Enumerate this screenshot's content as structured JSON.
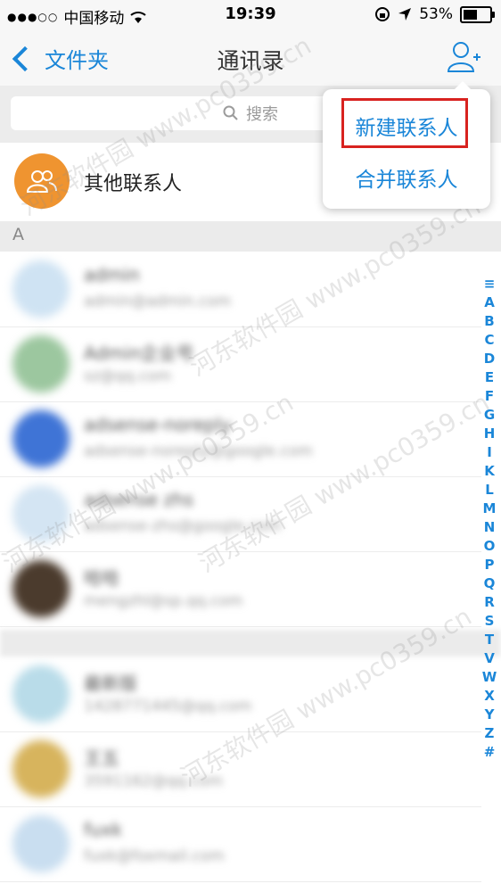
{
  "status": {
    "carrier": "中国移动",
    "time": "19:39",
    "battery": "53%"
  },
  "nav": {
    "back_label": "文件夹",
    "title": "通讯录"
  },
  "search": {
    "placeholder": "搜索"
  },
  "other_contacts": {
    "label": "其他联系人"
  },
  "section_a": "A",
  "contacts": [
    {
      "name": "admin",
      "sub": "admin@admin.com",
      "color": "#cfe3f3"
    },
    {
      "name": "Admin企业号",
      "sub": "sz@qq.com",
      "color": "#9cc79f"
    },
    {
      "name": "adsense-noreply",
      "sub": "adsense-noreply@google.com",
      "color": "#3f74d6"
    },
    {
      "name": "adsense zhs",
      "sub": "adsense-zhs@google.com",
      "color": "#d4e5f3"
    },
    {
      "name": "哈哈",
      "sub": "mengzhl@sp.qq.com",
      "color": "#4b3b2d"
    },
    {
      "name": "最新版",
      "sub": "1428771445@qq.com",
      "color": "#b9dce9"
    },
    {
      "name": "王五",
      "sub": "3591162@qq.com",
      "color": "#d7b45d"
    },
    {
      "name": "fuxk",
      "sub": "fuxk@foxmail.com",
      "color": "#c9def0"
    }
  ],
  "index_letters": [
    "≡",
    "A",
    "B",
    "C",
    "D",
    "E",
    "F",
    "G",
    "H",
    "I",
    "K",
    "L",
    "M",
    "N",
    "O",
    "P",
    "Q",
    "R",
    "S",
    "T",
    "V",
    "W",
    "X",
    "Y",
    "Z",
    "#"
  ],
  "popup": {
    "new_contact": "新建联系人",
    "merge_contacts": "合并联系人"
  },
  "watermark": "河东软件园 www.pc0359.cn"
}
